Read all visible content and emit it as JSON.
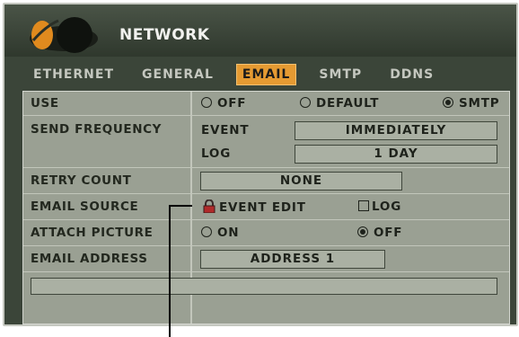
{
  "window": {
    "title": "NETWORK"
  },
  "tabs": [
    {
      "label": "ETHERNET",
      "active": false
    },
    {
      "label": "GENERAL",
      "active": false
    },
    {
      "label": "EMAIL",
      "active": true
    },
    {
      "label": "SMTP",
      "active": false
    },
    {
      "label": "DDNS",
      "active": false
    }
  ],
  "use": {
    "label": "USE",
    "options": [
      "OFF",
      "DEFAULT",
      "SMTP"
    ],
    "selected": "SMTP"
  },
  "send_frequency": {
    "label": "SEND FREQUENCY",
    "event_label": "EVENT",
    "event_value": "IMMEDIATELY",
    "log_label": "LOG",
    "log_value": "1 DAY"
  },
  "retry_count": {
    "label": "RETRY COUNT",
    "value": "NONE"
  },
  "email_source": {
    "label": "EMAIL SOURCE",
    "event_edit": "EVENT EDIT",
    "log_label": "LOG",
    "log_checked": false
  },
  "attach_picture": {
    "label": "ATTACH PICTURE",
    "options": [
      "ON",
      "OFF"
    ],
    "selected": "OFF"
  },
  "email_address": {
    "label": "EMAIL ADDRESS",
    "value": "ADDRESS 1",
    "address_text": ""
  },
  "colors": {
    "accent_tab": "#e59a32",
    "panel": "#9aa093",
    "frame": "#3b4539"
  },
  "icons": {
    "logo": "globe-logo-icon",
    "lock": "lock-icon"
  }
}
